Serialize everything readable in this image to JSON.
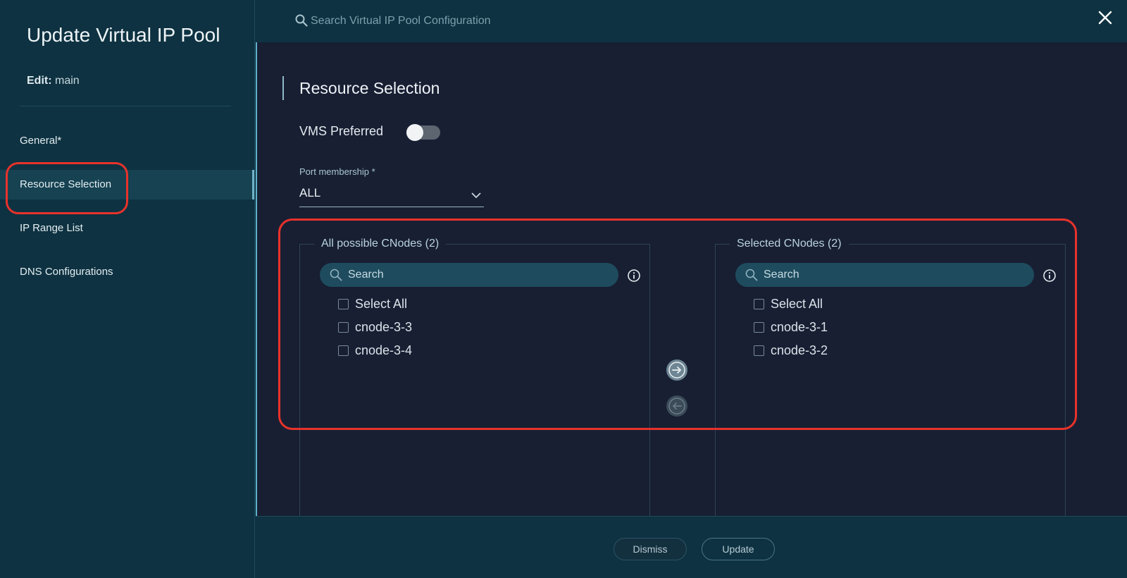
{
  "sidebar": {
    "title": "Update Virtual IP Pool",
    "edit_label": "Edit:",
    "edit_value": "main",
    "items": [
      {
        "label": "General*"
      },
      {
        "label": "Resource Selection",
        "active": true
      },
      {
        "label": "IP Range List"
      },
      {
        "label": "DNS Configurations"
      }
    ]
  },
  "header": {
    "search_placeholder": "Search Virtual IP Pool Configuration",
    "close_icon": "close-icon"
  },
  "main": {
    "section_title": "Resource Selection",
    "vms_preferred": {
      "label": "VMS Preferred",
      "on": false
    },
    "port_membership": {
      "label": "Port membership *",
      "value": "ALL"
    },
    "available": {
      "legend": "All possible CNodes (2)",
      "search_placeholder": "Search",
      "select_all": "Select All",
      "items": [
        "cnode-3-3",
        "cnode-3-4"
      ]
    },
    "selected": {
      "legend": "Selected CNodes (2)",
      "search_placeholder": "Search",
      "select_all": "Select All",
      "items": [
        "cnode-3-1",
        "cnode-3-2"
      ]
    }
  },
  "footer": {
    "dismiss_label": "Dismiss",
    "update_label": "Update"
  },
  "colors": {
    "sidebar_bg": "#0e3241",
    "panel_bg": "#181f33",
    "accent": "#5fb0cc",
    "annotation": "#e8322b"
  }
}
